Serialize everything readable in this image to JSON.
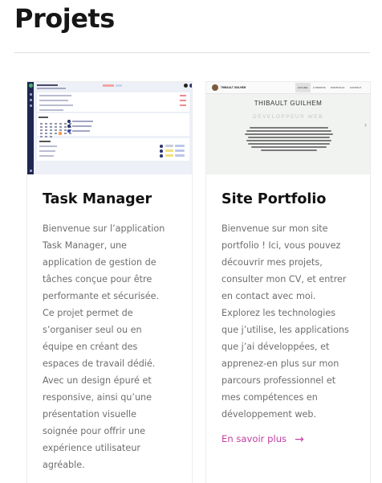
{
  "page": {
    "title": "Projets"
  },
  "projects": [
    {
      "title": "Task Manager",
      "description_lines": [
        "Bienvenue sur l’application",
        "Task Manager, une",
        "application de gestion de",
        "tâches conçue pour être",
        "performante et sécurisée.",
        "Ce projet permet de",
        "s’organiser seul ou en",
        "équipe en créant des",
        "espaces de travail dédié.",
        "Avec un design épuré et",
        "responsive, ainsi qu’une",
        "présentation visuelle",
        "soignée pour offrir une",
        "expérience utilisateur",
        "agréable."
      ]
    },
    {
      "title": "Site Portfolio",
      "description_lines": [
        "Bienvenue sur mon site",
        "portfolio ! Ici, vous pouvez",
        "découvrir mes projets,",
        "consulter mon CV, et entrer",
        "en contact avec moi.",
        "Explorez les technologies",
        "que j’utilise, les applications",
        "que j’ai développées, et",
        "apprenez-en plus sur mon",
        "parcours professionnel et",
        "mes compétences en",
        "développement web."
      ],
      "link_label": "En savoir plus",
      "link_arrow": "→",
      "preview": {
        "name": "THIBAULT GUILHEM",
        "nav": [
          "ACCUEIL",
          "À PROPOS",
          "PORTFOLIO",
          "CONTACT"
        ],
        "heading": "THIBAULT GUILHEM",
        "subheading": "DÉVELOPPEUR WEB",
        "next_arrow": "›"
      }
    }
  ],
  "colors": {
    "accent": "#c23fa2",
    "text_muted": "#6e6e6e",
    "sidebar": "#1d2752"
  }
}
